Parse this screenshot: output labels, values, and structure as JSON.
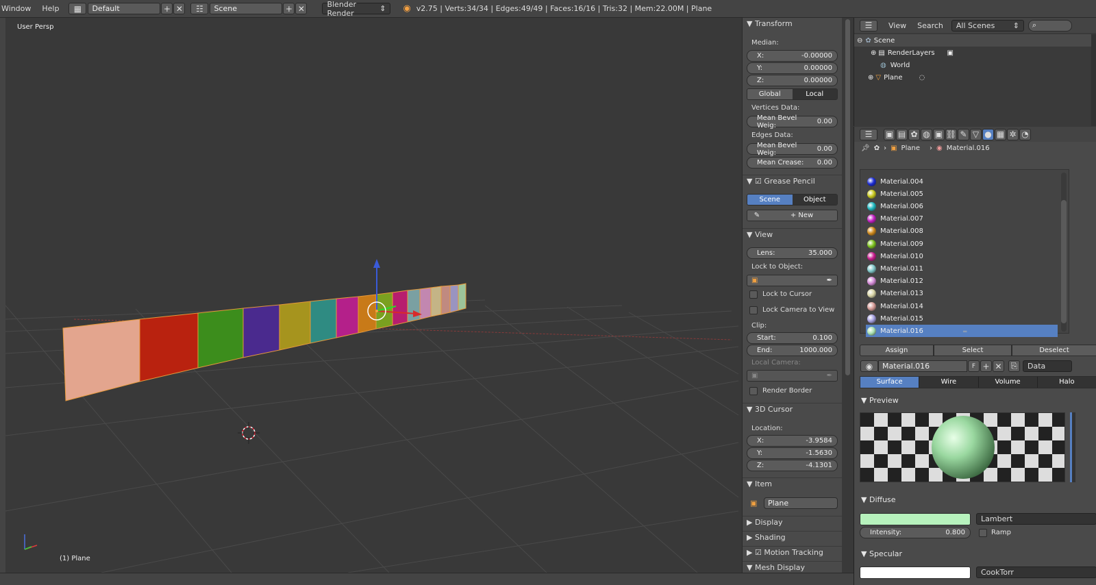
{
  "topbar": {
    "menu_window": "Window",
    "menu_help": "Help",
    "layout": "Default",
    "scene": "Scene",
    "renderer": "Blender Render",
    "stats": "v2.75 | Verts:34/34 | Edges:49/49 | Faces:16/16 | Tris:32 | Mem:22.00M | Plane"
  },
  "viewport": {
    "persp_label": "User Persp",
    "object_label": "(1) Plane"
  },
  "npanel": {
    "transform": {
      "header": "Transform",
      "median": "Median:",
      "x_label": "X:",
      "x": "-0.00000",
      "y_label": "Y:",
      "y": "0.00000",
      "z_label": "Z:",
      "z": "0.00000",
      "global": "Global",
      "local": "Local",
      "vertices_data": "Vertices Data:",
      "mean_bevel_v_label": "Mean Bevel Weig:",
      "mean_bevel_v": "0.00",
      "edges_data": "Edges Data:",
      "mean_bevel_e_label": "Mean Bevel Weig:",
      "mean_bevel_e": "0.00",
      "mean_crease_label": "Mean Crease:",
      "mean_crease": "0.00"
    },
    "grease": {
      "header": "Grease Pencil",
      "scene": "Scene",
      "object": "Object",
      "new": "New"
    },
    "view": {
      "header": "View",
      "lens_label": "Lens:",
      "lens": "35.000",
      "lock_object": "Lock to Object:",
      "lock_cursor": "Lock to Cursor",
      "lock_camera": "Lock Camera to View",
      "clip": "Clip:",
      "start_label": "Start:",
      "start": "0.100",
      "end_label": "End:",
      "end": "1000.000",
      "local_camera": "Local Camera:",
      "render_border": "Render Border"
    },
    "cursor": {
      "header": "3D Cursor",
      "location": "Location:",
      "x_label": "X:",
      "x": "-3.9584",
      "y_label": "Y:",
      "y": "-1.5630",
      "z_label": "Z:",
      "z": "-4.1301"
    },
    "item": {
      "header": "Item",
      "name": "Plane"
    },
    "display": "Display",
    "shading": "Shading",
    "motion_tracking": "Motion Tracking",
    "mesh_display": "Mesh Display"
  },
  "outliner": {
    "view": "View",
    "search": "Search",
    "filter": "All Scenes",
    "scene": "Scene",
    "render_layers": "RenderLayers",
    "world": "World",
    "plane": "Plane"
  },
  "props": {
    "breadcrumb_object": "Plane",
    "breadcrumb_material": "Material.016",
    "materials": [
      {
        "name": "Material.004",
        "color": "#1a2bd6"
      },
      {
        "name": "Material.005",
        "color": "#c8c81e"
      },
      {
        "name": "Material.006",
        "color": "#1fb8c0"
      },
      {
        "name": "Material.007",
        "color": "#c21ec2"
      },
      {
        "name": "Material.008",
        "color": "#d08a1c"
      },
      {
        "name": "Material.009",
        "color": "#7dc21e"
      },
      {
        "name": "Material.010",
        "color": "#c71c8e"
      },
      {
        "name": "Material.011",
        "color": "#7fc6c8"
      },
      {
        "name": "Material.012",
        "color": "#d38ad6"
      },
      {
        "name": "Material.013",
        "color": "#d8d4a6"
      },
      {
        "name": "Material.014",
        "color": "#d49a96"
      },
      {
        "name": "Material.015",
        "color": "#a49ee0"
      },
      {
        "name": "Material.016",
        "color": "#a8e0b0"
      }
    ],
    "selected_material_color": "#5680c2",
    "assign": "Assign",
    "select": "Select",
    "deselect": "Deselect",
    "material_name": "Material.016",
    "fake_user": "F",
    "link": "Data",
    "tabs": {
      "surface": "Surface",
      "wire": "Wire",
      "volume": "Volume",
      "halo": "Halo"
    },
    "preview": "Preview",
    "diffuse": {
      "header": "Diffuse",
      "color": "#b7f2bd",
      "shader": "Lambert",
      "intensity_label": "Intensity:",
      "intensity": "0.800",
      "ramp": "Ramp"
    },
    "specular": {
      "header": "Specular",
      "shader": "CookTorr"
    }
  }
}
